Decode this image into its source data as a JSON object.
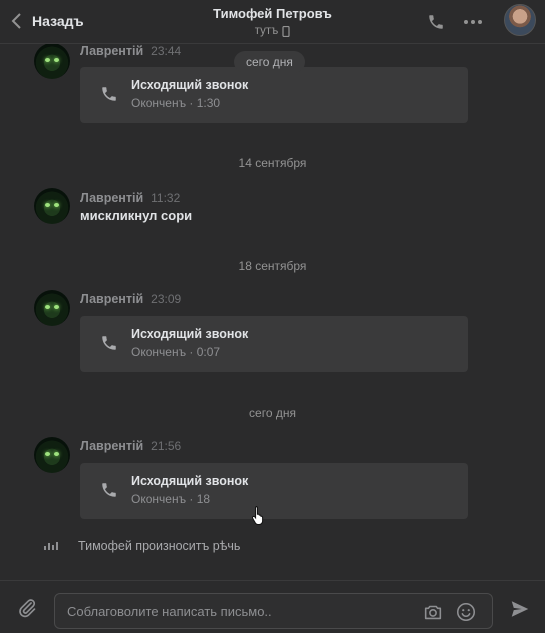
{
  "header": {
    "back_label": "Назадъ",
    "peer_name": "Тимофей Петровъ",
    "peer_status": "тутъ"
  },
  "sticky_date": "сего дня",
  "messages": [
    {
      "author": "Лаврентій",
      "time": "23:44",
      "call_title": "Исходящий звонок",
      "call_sub": "Оконченъ · 1:30"
    },
    {
      "author": "Лаврентій",
      "time": "11:32",
      "text": "мискликнул сори"
    },
    {
      "author": "Лаврентій",
      "time": "23:09",
      "call_title": "Исходящий звонок",
      "call_sub": "Оконченъ · 0:07"
    },
    {
      "author": "Лаврентій",
      "time": "21:56",
      "call_title": "Исходящий звонок",
      "call_sub": "Оконченъ · 18"
    }
  ],
  "date_separators": [
    "14 сентября",
    "18 сентября",
    "сего дня"
  ],
  "typing_text": "Тимофей произноситъ рѣчь",
  "composer": {
    "placeholder": "Соблаговолите написать письмо.."
  },
  "icons": {
    "back": "chevron-left-icon",
    "call": "phone-icon",
    "more": "more-horizontal-icon",
    "status_device": "mobile-phone-icon",
    "attach": "paperclip-icon",
    "camera": "camera-icon",
    "emoji": "smile-icon",
    "send": "send-icon"
  },
  "colors": {
    "background": "#2b2b2c",
    "card": "#3a3a3b",
    "text": "#e1e3e6",
    "muted": "#8e8f92"
  }
}
